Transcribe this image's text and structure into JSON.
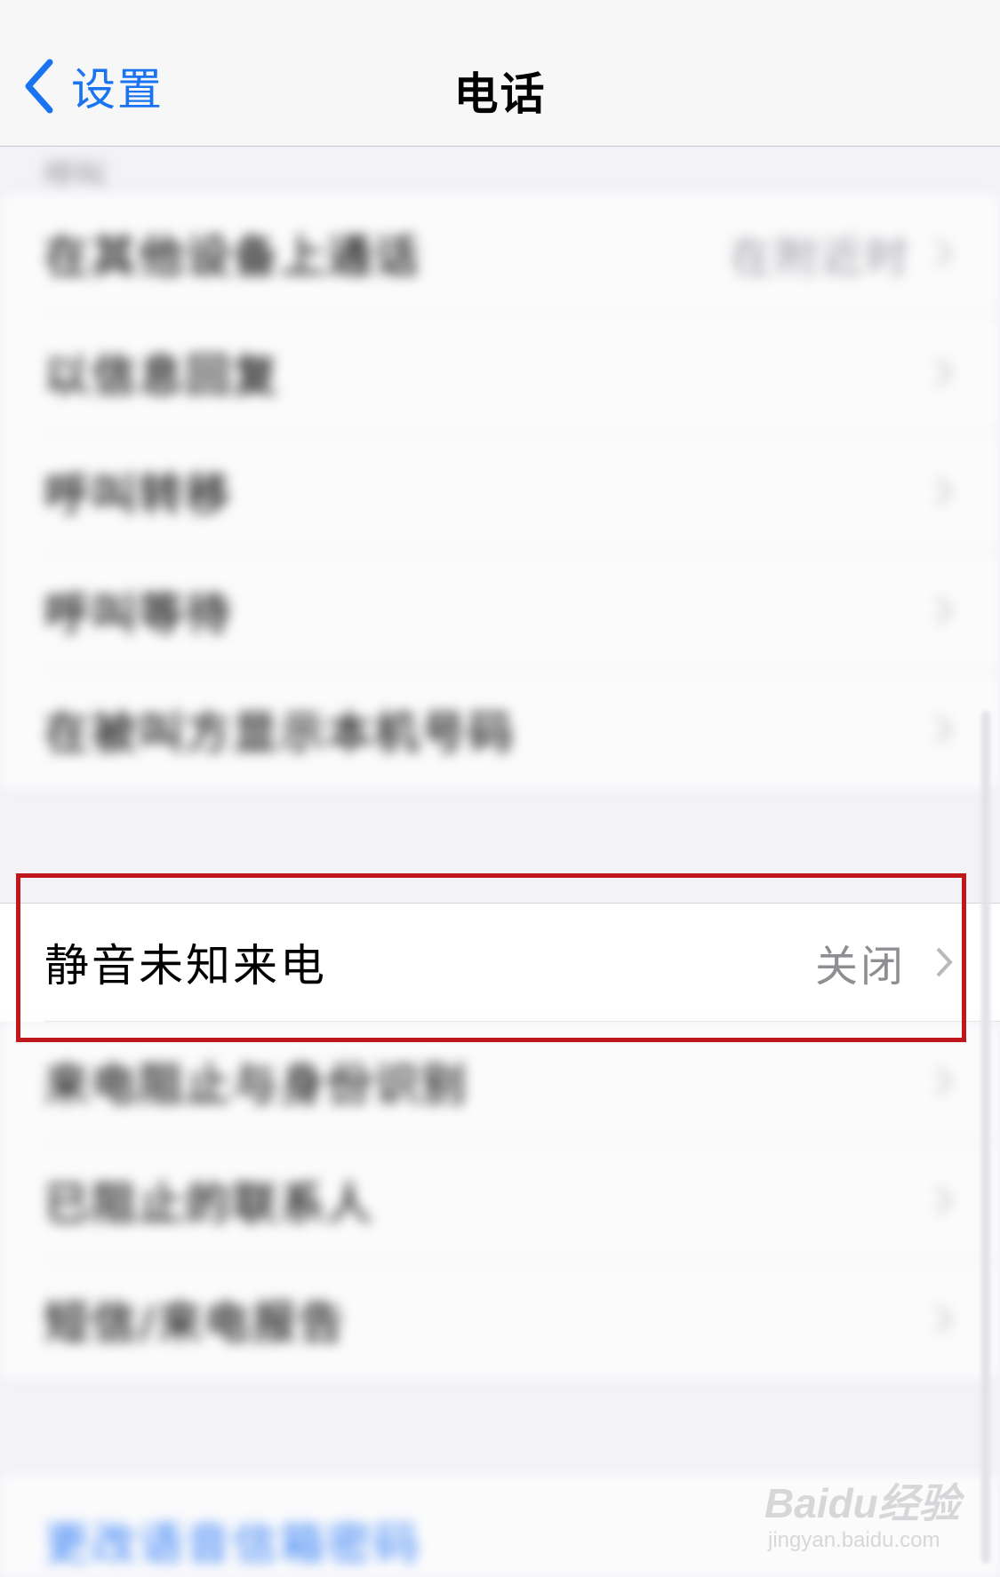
{
  "nav": {
    "back_label": "设置",
    "title": "电话"
  },
  "calls_section": {
    "header": "呼叫",
    "items": [
      {
        "label": "在其他设备上通话",
        "value": "在附近时"
      },
      {
        "label": "以信息回复",
        "value": ""
      },
      {
        "label": "呼叫转移",
        "value": ""
      },
      {
        "label": "呼叫等待",
        "value": ""
      },
      {
        "label": "在被叫方显示本机号码",
        "value": ""
      }
    ]
  },
  "highlighted_row": {
    "label": "静音未知来电",
    "value": "关闭"
  },
  "blocking_section": {
    "items": [
      {
        "label": "来电阻止与身份识别"
      },
      {
        "label": "已阻止的联系人"
      },
      {
        "label": "短信/来电报告"
      }
    ]
  },
  "voicemail_link": {
    "label": "更改语音信箱密码"
  },
  "watermark": {
    "brand": "Baidu经验",
    "url": "jingyan.baidu.com"
  },
  "colors": {
    "accent": "#1a73f0",
    "highlight_border": "#c0171c",
    "background": "#f2f2f7"
  },
  "icons": [
    "chevron-left-icon",
    "chevron-right-icon"
  ]
}
